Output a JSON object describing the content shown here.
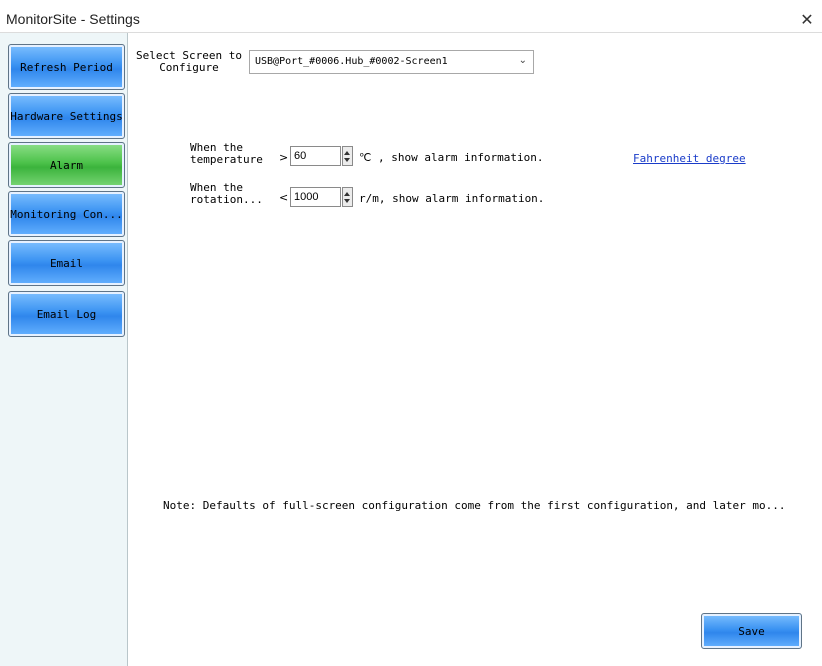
{
  "window": {
    "title": "MonitorSite - Settings",
    "close_glyph": "✕"
  },
  "sidebar": {
    "items": [
      {
        "label": "Refresh Period"
      },
      {
        "label": "Hardware Settings"
      },
      {
        "label": "Alarm",
        "active": true
      },
      {
        "label": "Monitoring Con..."
      },
      {
        "label": "Email"
      },
      {
        "label": "Email Log"
      }
    ]
  },
  "screen_select": {
    "label": "Select Screen to Configure",
    "value": "USB@Port_#0006.Hub_#0002-Screen1"
  },
  "alarm": {
    "temperature": {
      "label": "When the temperature",
      "operator": ">",
      "value": "60",
      "suffix": "℃ , show alarm information.",
      "link": "Fahrenheit degree"
    },
    "rotation": {
      "label": "When the rotation...",
      "operator": "<",
      "value": "1000",
      "suffix": "r/m, show alarm information."
    }
  },
  "note": "Note: Defaults of full-screen configuration come from the first configuration, and later mo...",
  "save_label": "Save",
  "colors": {
    "nav_blue": "#3b93f2",
    "nav_active_green": "#4cc24a",
    "link_blue": "#1a3cc9"
  }
}
